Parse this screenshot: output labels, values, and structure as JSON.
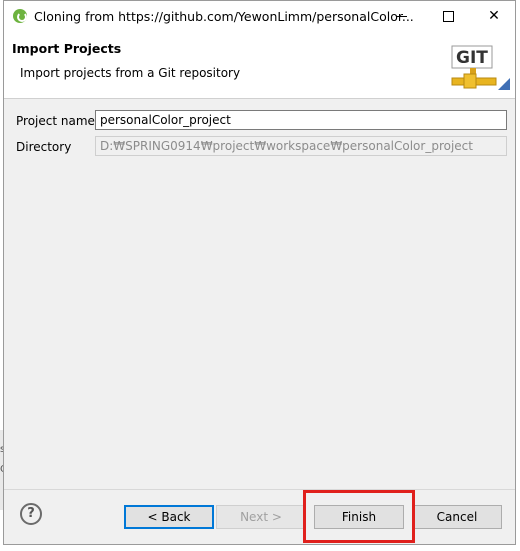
{
  "window": {
    "title": "Cloning from https://github.com/YewonLimm/personalColor...",
    "controls": {
      "minimize": "—",
      "maximize": "□",
      "close": "✕"
    }
  },
  "header": {
    "title": "Import Projects",
    "description": "Import projects from a Git repository",
    "logo_text": "GIT"
  },
  "form": {
    "project_name_label": "Project name",
    "project_name_value": "personalColor_project",
    "directory_label": "Directory",
    "directory_value": "D:₩SPRING0914₩project₩workspace₩personalColor_project"
  },
  "buttons": {
    "help": "?",
    "back": "< Back",
    "next": "Next >",
    "finish": "Finish",
    "cancel": "Cancel"
  },
  "colors": {
    "highlight": "#e0201c",
    "default_button_border": "#0078d7"
  }
}
